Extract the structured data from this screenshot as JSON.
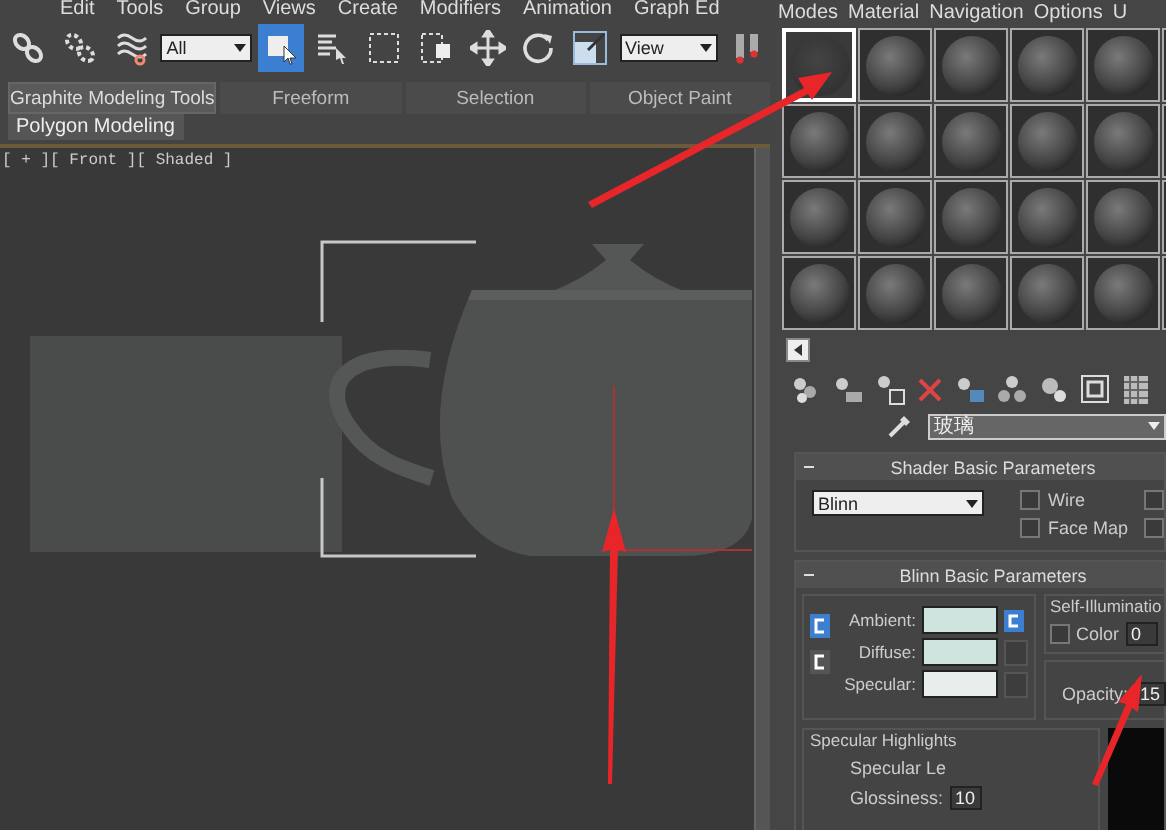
{
  "main_menu": [
    "Edit",
    "Tools",
    "Group",
    "Views",
    "Create",
    "Modifiers",
    "Animation",
    "Graph Ed"
  ],
  "toolbar": {
    "tools": [
      {
        "kind": "link",
        "selected": false
      },
      {
        "kind": "unlink",
        "selected": false
      },
      {
        "kind": "bind",
        "selected": false
      },
      {
        "kind": "filter"
      },
      {
        "kind": "select",
        "selected": true
      },
      {
        "kind": "select-by-name",
        "selected": false
      },
      {
        "kind": "region",
        "selected": false
      },
      {
        "kind": "crossing",
        "selected": false
      },
      {
        "kind": "move",
        "selected": false
      },
      {
        "kind": "rotate",
        "selected": false
      },
      {
        "kind": "scale",
        "selected": false
      },
      {
        "kind": "coords"
      },
      {
        "kind": "pivot",
        "selected": false
      }
    ],
    "selection_filter": "All",
    "reference_coord": "View"
  },
  "ribbon_tabs": [
    {
      "label": "Graphite Modeling Tools",
      "selected": true
    },
    {
      "label": "Freeform",
      "selected": false
    },
    {
      "label": "Selection",
      "selected": false
    },
    {
      "label": "Object Paint",
      "selected": false
    }
  ],
  "ribbon_panel": "Polygon Modeling",
  "viewport": {
    "label": "[ + ][ Front ][ Shaded ]"
  },
  "material_editor": {
    "menu": [
      "Modes",
      "Material",
      "Navigation",
      "Options",
      "U"
    ],
    "slots": [
      {
        "selected": true
      },
      {
        "selected": false
      },
      {
        "selected": false
      },
      {
        "selected": false
      },
      {
        "selected": false
      },
      {
        "selected": false
      },
      {
        "selected": false
      },
      {
        "selected": false
      },
      {
        "selected": false
      },
      {
        "selected": false
      },
      {
        "selected": false
      },
      {
        "selected": false
      },
      {
        "selected": false
      },
      {
        "selected": false
      },
      {
        "selected": false
      },
      {
        "selected": false
      },
      {
        "selected": false
      },
      {
        "selected": false
      },
      {
        "selected": false
      },
      {
        "selected": false
      },
      {
        "selected": false
      },
      {
        "selected": false
      },
      {
        "selected": false
      },
      {
        "selected": false
      }
    ],
    "material_name": "玻璃",
    "shader": {
      "title": "Shader Basic Parameters",
      "type": "Blinn",
      "options": [
        {
          "label": "Wire",
          "checked": false
        },
        {
          "label": "Face Map",
          "checked": false
        }
      ],
      "column_3": [
        {
          "checked": false
        },
        {
          "checked": false
        }
      ]
    },
    "blinn": {
      "title": "Blinn Basic Parameters",
      "colors": [
        {
          "label": "Ambient:",
          "color": "#cfe3df"
        },
        {
          "label": "Diffuse:",
          "color": "#cfe3df"
        },
        {
          "label": "Specular:",
          "color": "#e8eeec"
        }
      ],
      "self_illumination": {
        "title": "Self-Illuminatio",
        "color_label": "Color",
        "color_checked": false,
        "value": "0"
      },
      "opacity": {
        "label": "Opacity:",
        "value": "15"
      },
      "specular_highlights": {
        "title": "Specular Highlights",
        "specular_level_label": "Specular Le",
        "glossiness_label": "Glossiness:",
        "glossiness_value": "10"
      }
    }
  }
}
